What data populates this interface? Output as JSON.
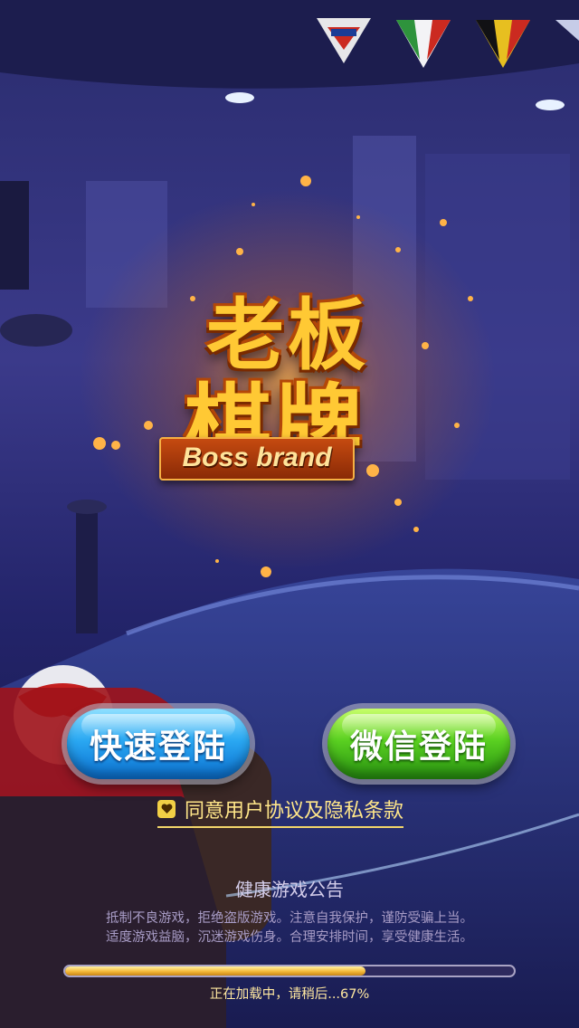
{
  "logo": {
    "title_line1": "老板",
    "title_line2": "棋牌",
    "subtitle": "Boss brand"
  },
  "buttons": {
    "quick_login": "快速登陆",
    "wechat_login": "微信登陆"
  },
  "agreement": {
    "checked": true,
    "text": "同意用户协议及隐私条款"
  },
  "notice": {
    "title": "健康游戏公告",
    "line1": "抵制不良游戏，拒绝盗版游戏。注意自我保护，谨防受骗上当。",
    "line2": "适度游戏益脑，沉迷游戏伤身。合理安排时间，享受健康生活。"
  },
  "loading": {
    "progress": 0.67,
    "text": "正在加载中，请稍后...67%"
  },
  "colors": {
    "quick_login": "#2aa8f2",
    "wechat_login": "#5ad021",
    "gold": "#ffc934"
  }
}
